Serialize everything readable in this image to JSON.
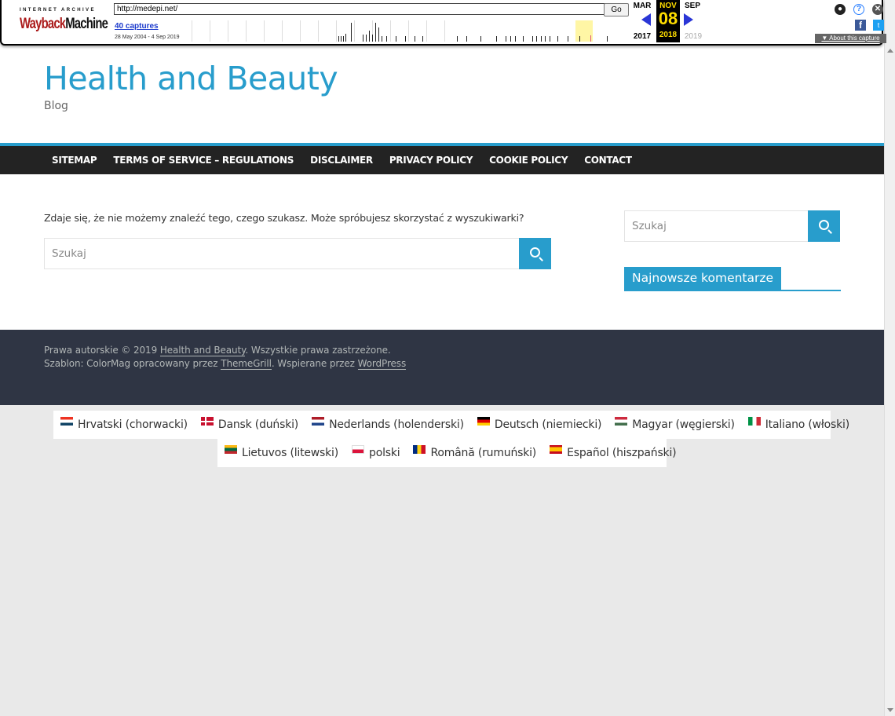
{
  "wayback": {
    "logo_top": "INTERNET ARCHIVE",
    "logo_main_1": "Wayback",
    "logo_main_2": "Machine",
    "url": "http://medepi.net/",
    "go_label": "Go",
    "captures": "40 captures",
    "range": "28 May 2004 - 4 Sep 2019",
    "prev_month": "MAR",
    "cur_month": "NOV",
    "next_month": "SEP",
    "cur_day": "08",
    "prev_year": "2017",
    "cur_year": "2018",
    "next_year": "2019",
    "about": "About this capture",
    "accent": "#ffde00"
  },
  "site": {
    "title": "Health and Beauty",
    "description": "Blog",
    "accent": "#289dcc"
  },
  "nav": {
    "items": [
      "SITEMAP",
      "TERMS OF SERVICE – REGULATIONS",
      "DISCLAIMER",
      "PRIVACY POLICY",
      "COOKIE POLICY",
      "CONTACT"
    ]
  },
  "content": {
    "not_found": "Zdaje się, że nie możemy znaleźć tego, czego szukasz. Może spróbujesz skorzystać z wyszukiwarki?",
    "search_placeholder": "Szukaj"
  },
  "sidebar": {
    "search_placeholder": "Szukaj",
    "widget_title": "Najnowsze komentarze"
  },
  "footer": {
    "copyright_prefix": "Prawa autorskie © 2019 ",
    "copyright_link": "Health and Beauty",
    "copyright_suffix": ". Wszystkie prawa zastrzeżone.",
    "theme_prefix": "Szablon: ColorMag opracowany przez ",
    "theme_link": "ThemeGrill",
    "theme_mid": ". Wspierane przez ",
    "wp_link": "WordPress"
  },
  "languages": [
    {
      "label": "Hrvatski (chorwacki)",
      "flag": "croatia-flag-icon"
    },
    {
      "label": "Dansk (duński)",
      "flag": "denmark-flag-icon"
    },
    {
      "label": "Nederlands (holenderski)",
      "flag": "netherlands-flag-icon"
    },
    {
      "label": "Deutsch (niemiecki)",
      "flag": "germany-flag-icon"
    },
    {
      "label": "Magyar (węgierski)",
      "flag": "hungary-flag-icon"
    },
    {
      "label": "Italiano (włoski)",
      "flag": "italy-flag-icon"
    },
    {
      "label": "Lietuvos (litewski)",
      "flag": "lithuania-flag-icon"
    },
    {
      "label": "polski",
      "flag": "poland-flag-icon"
    },
    {
      "label": "Română (rumuński)",
      "flag": "romania-flag-icon"
    },
    {
      "label": "Español (hiszpański)",
      "flag": "spain-flag-icon"
    }
  ]
}
